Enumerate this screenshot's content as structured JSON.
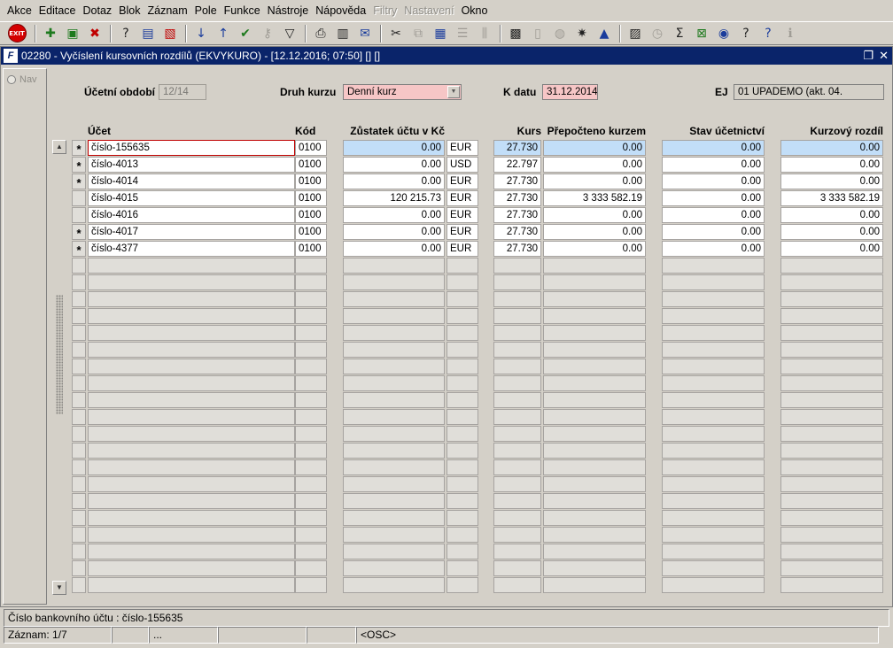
{
  "menu": [
    "Akce",
    "Editace",
    "Dotaz",
    "Blok",
    "Záznam",
    "Pole",
    "Funkce",
    "Nástroje",
    "Nápověda",
    "Filtry",
    "Nastavení",
    "Okno"
  ],
  "menu_disabled": [
    "Filtry",
    "Nastavení"
  ],
  "toolbar": {
    "exit_label": "EXIT",
    "icons": [
      "exit-icon",
      "insert-record-icon",
      "save-record-icon",
      "delete-record-icon",
      "query-icon",
      "execute-query-icon",
      "cancel-query-icon",
      "sort-asc-icon",
      "sort-desc-icon",
      "checkmark-icon",
      "key-icon",
      "filter-icon",
      "print-icon",
      "print-preview-icon",
      "mail-icon",
      "cut-icon",
      "copy-icon",
      "paste-icon",
      "list-icon",
      "columns-icon",
      "calculator-icon",
      "document-icon",
      "globe-icon",
      "settings-icon",
      "triangle-icon",
      "report-icon",
      "clock-icon",
      "sigma-icon",
      "excel-icon",
      "info-icon",
      "help-icon",
      "context-help-icon",
      "info-i-icon"
    ]
  },
  "window": {
    "title": "02280 - Vyčíslení kursovních rozdílů (EKVYKURO) - [12.12.2016; 07:50] [] []",
    "app_icon": "F"
  },
  "nav": {
    "label": "Nav"
  },
  "header": {
    "period_label": "Účetní období",
    "period_value": "12/14",
    "rate_type_label": "Druh kurzu",
    "rate_type_value": "Denní kurz",
    "date_label": "K datu",
    "date_value": "31.12.2014",
    "ej_label": "EJ",
    "ej_value": "01 UPADEMO (akt. 04."
  },
  "columns": {
    "account": "Účet",
    "code": "Kód",
    "balance": "Zůstatek účtu v Kč",
    "rate": "Kurs",
    "converted": "Přepočteno kurzem",
    "ledger": "Stav účetnictví",
    "difference": "Kurzový rozdíl"
  },
  "rows": [
    {
      "mark": "*",
      "account": "číslo-155635",
      "code": "0100",
      "balance": "0.00",
      "currency": "EUR",
      "rate": "27.730",
      "converted": "0.00",
      "ledger": "0.00",
      "difference": "0.00"
    },
    {
      "mark": "*",
      "account": "číslo-4013",
      "code": "0100",
      "balance": "0.00",
      "currency": "USD",
      "rate": "22.797",
      "converted": "0.00",
      "ledger": "0.00",
      "difference": "0.00"
    },
    {
      "mark": "*",
      "account": "číslo-4014",
      "code": "0100",
      "balance": "0.00",
      "currency": "EUR",
      "rate": "27.730",
      "converted": "0.00",
      "ledger": "0.00",
      "difference": "0.00"
    },
    {
      "mark": "",
      "account": "číslo-4015",
      "code": "0100",
      "balance": "120 215.73",
      "currency": "EUR",
      "rate": "27.730",
      "converted": "3 333 582.19",
      "ledger": "0.00",
      "difference": "3 333 582.19"
    },
    {
      "mark": "",
      "account": "číslo-4016",
      "code": "0100",
      "balance": "0.00",
      "currency": "EUR",
      "rate": "27.730",
      "converted": "0.00",
      "ledger": "0.00",
      "difference": "0.00"
    },
    {
      "mark": "*",
      "account": "číslo-4017",
      "code": "0100",
      "balance": "0.00",
      "currency": "EUR",
      "rate": "27.730",
      "converted": "0.00",
      "ledger": "0.00",
      "difference": "0.00"
    },
    {
      "mark": "*",
      "account": "číslo-4377",
      "code": "0100",
      "balance": "0.00",
      "currency": "EUR",
      "rate": "27.730",
      "converted": "0.00",
      "ledger": "0.00",
      "difference": "0.00"
    }
  ],
  "status": {
    "hint": "Číslo bankovního účtu : číslo-155635",
    "record": "Záznam: 1/7",
    "ellipsis": "...",
    "mode": "<OSC>"
  }
}
